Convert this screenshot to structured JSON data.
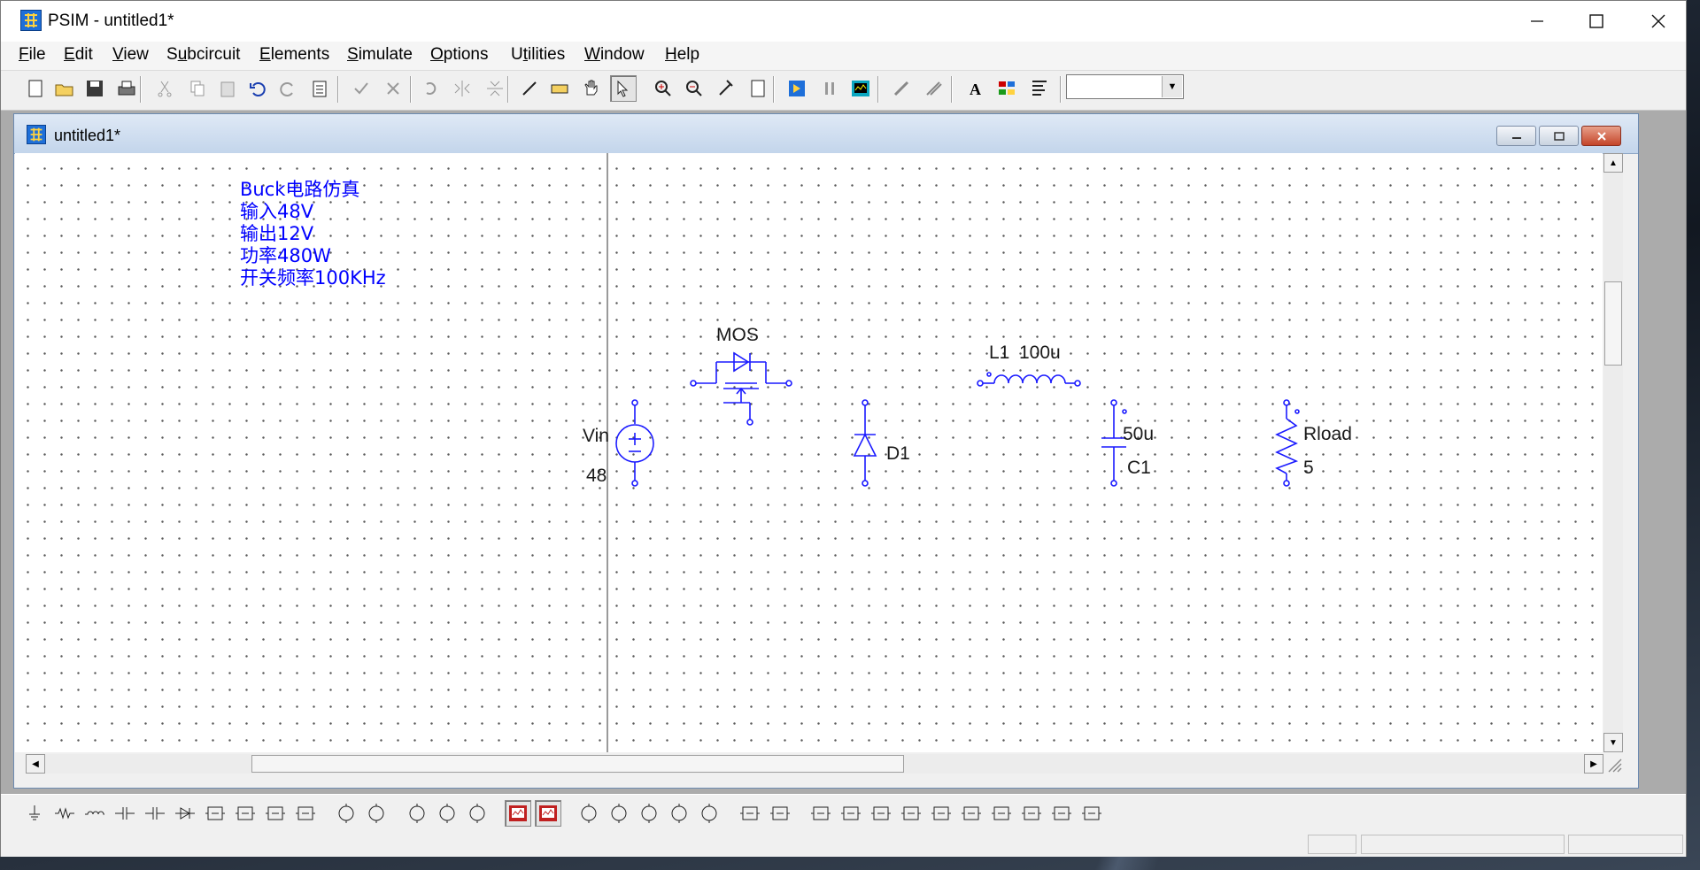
{
  "window": {
    "title": "PSIM - untitled1*"
  },
  "menu": [
    {
      "label": "File",
      "hotkey_index": 0
    },
    {
      "label": "Edit",
      "hotkey_index": 0
    },
    {
      "label": "View",
      "hotkey_index": 0
    },
    {
      "label": "Subcircuit",
      "hotkey_index": 1
    },
    {
      "label": "Elements",
      "hotkey_index": 0
    },
    {
      "label": "Simulate",
      "hotkey_index": 0
    },
    {
      "label": "Options",
      "hotkey_index": 0
    },
    {
      "label": "Utilities",
      "hotkey_index": 1
    },
    {
      "label": "Window",
      "hotkey_index": 0
    },
    {
      "label": "Help",
      "hotkey_index": 0
    }
  ],
  "toolbar": {
    "buttons": [
      "new-icon",
      "open-icon",
      "save-icon",
      "print-icon",
      "cut-icon",
      "copy-icon",
      "paste-icon",
      "undo-icon",
      "redo-icon",
      "paste-special-icon",
      "check-icon",
      "cross-icon",
      "rotate-icon",
      "flip-lr-icon",
      "flip-tb-icon",
      "wire-icon",
      "label-icon",
      "pan-hand-icon",
      "select-arrow-icon",
      "zoom-in-icon",
      "zoom-out-icon",
      "zoom-fit-icon",
      "page-icon",
      "run-simulation-icon",
      "pause-icon",
      "simview-icon",
      "probe-voltage-icon",
      "probe-current-icon",
      "text-icon",
      "parts-icon",
      "netlist-icon"
    ],
    "combo_value": ""
  },
  "document": {
    "title": "untitled1*",
    "note_lines": [
      "Buck电路仿真",
      "输入48V",
      "输出12V",
      "功率480W",
      "开关频率100KHz"
    ],
    "components": {
      "mos": {
        "name": "MOS"
      },
      "vin": {
        "name": "Vin",
        "value": "48"
      },
      "diode": {
        "name": "D1"
      },
      "inductor": {
        "name": "L1",
        "value": "100u"
      },
      "capacitor": {
        "name": "C1",
        "value": "50u"
      },
      "resistor": {
        "name": "Rload",
        "value": "5"
      }
    }
  },
  "element_bar": {
    "buttons": [
      "ground-icon",
      "resistor-icon",
      "inductor-icon",
      "capacitor-icon",
      "electrolytic-capacitor-icon",
      "diode-icon",
      "mosfet-icon",
      "igbt-icon",
      "thyristor-icon",
      "switch-icon",
      "dc-source-icon",
      "sine-source-icon",
      "voltage-probe-icon",
      "ammeter-icon",
      "voltmeter-icon",
      "scope-icon",
      "scope2-icon",
      "current-source-icon",
      "ac-source-icon",
      "square-source-icon",
      "triangle-source-icon",
      "step-source-icon",
      "gating-block-icon",
      "comparator-icon",
      "controller-icon",
      "pi-controller-icon",
      "transfer-function-icon",
      "filter-icon",
      "summer-icon",
      "gain-icon",
      "limiter-icon",
      "sampler-icon",
      "multiplier-icon",
      "divider-icon"
    ]
  },
  "colors": {
    "schematic": "#1a1aff",
    "note": "#0000ff",
    "title_bar": "#c3d5eb"
  }
}
